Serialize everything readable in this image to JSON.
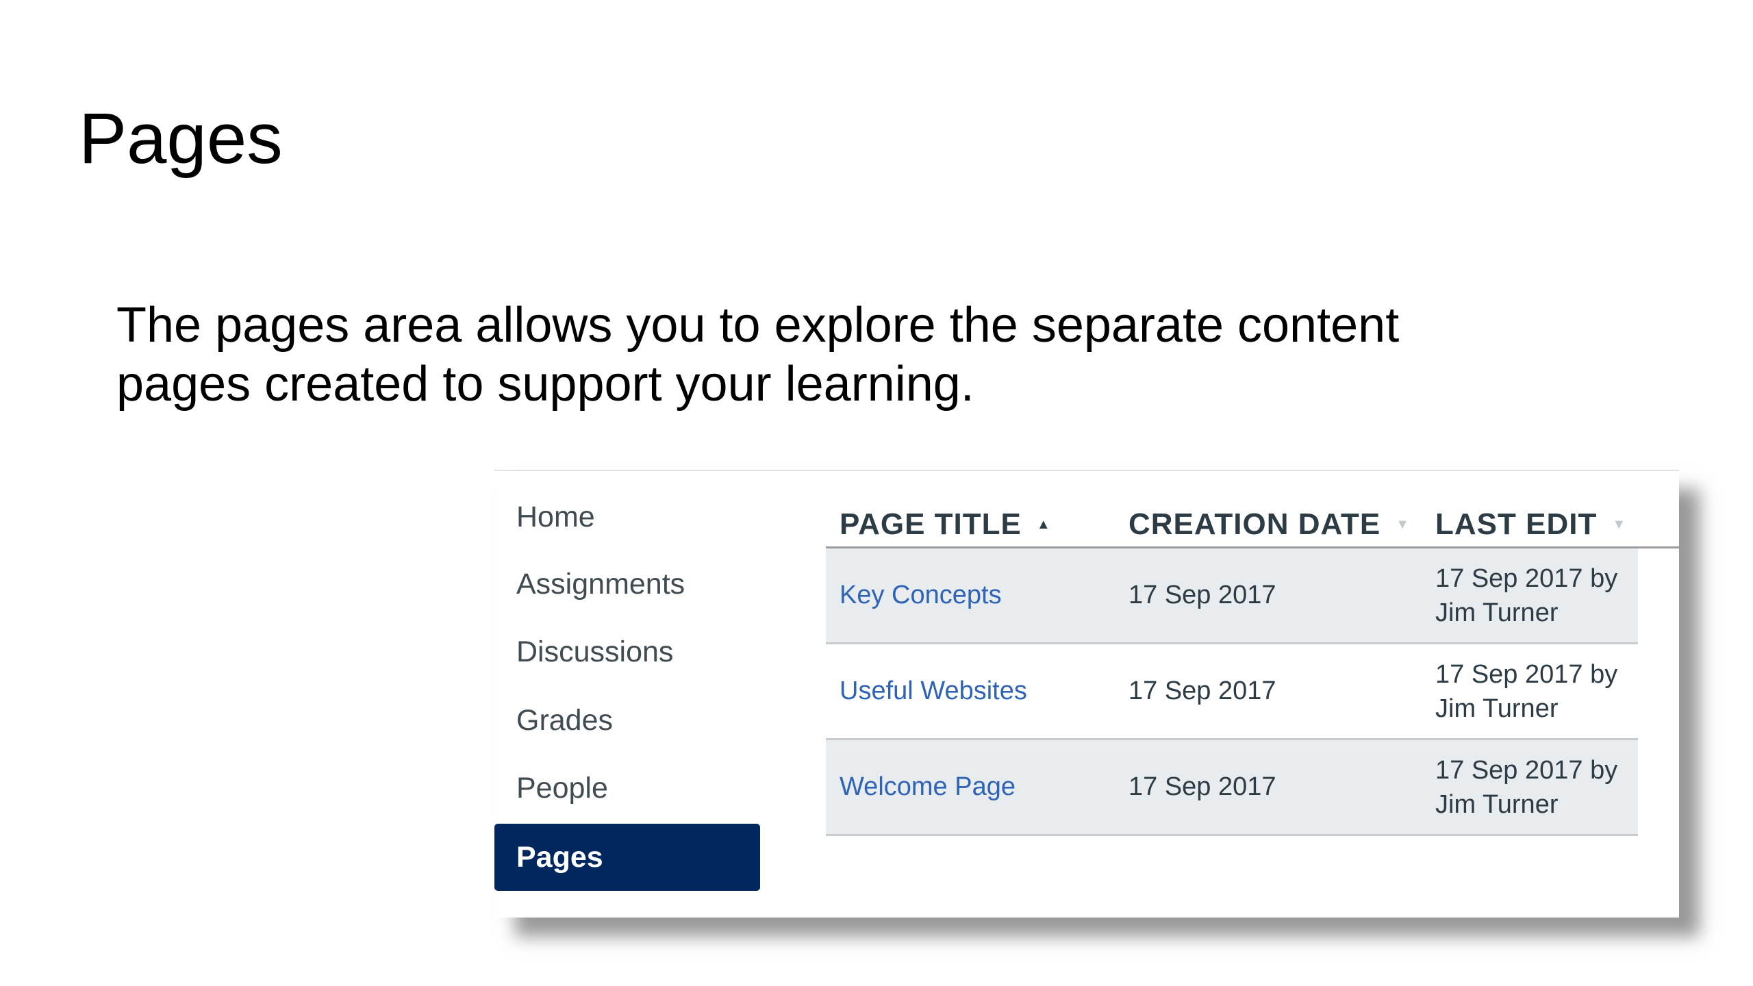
{
  "slide": {
    "title": "Pages",
    "body_lines": [
      "The pages area allows you to explore the separate content",
      "pages created to support your learning."
    ]
  },
  "screenshot": {
    "nav": {
      "items": [
        {
          "label": "Home"
        },
        {
          "label": "Assignments"
        },
        {
          "label": "Discussions"
        },
        {
          "label": "Grades"
        },
        {
          "label": "People"
        },
        {
          "label": "Pages",
          "active": true
        }
      ]
    },
    "table": {
      "columns": [
        {
          "label": "PAGE TITLE",
          "sort": "ascending"
        },
        {
          "label": "CREATION DATE",
          "sort": "none"
        },
        {
          "label": "LAST EDIT",
          "sort": "none"
        }
      ],
      "rows": [
        {
          "title": "Key Concepts",
          "created": "17 Sep 2017",
          "edit_line1": "17 Sep 2017 by",
          "edit_line2": "Jim Turner"
        },
        {
          "title": "Useful Websites",
          "created": "17 Sep 2017",
          "edit_line1": "17 Sep 2017 by",
          "edit_line2": "Jim Turner"
        },
        {
          "title": "Welcome Page",
          "created": "17 Sep 2017",
          "edit_line1": "17 Sep 2017 by",
          "edit_line2": "Jim Turner"
        }
      ]
    },
    "colors": {
      "active_nav_bg": "#00275e",
      "link": "#2e63b5",
      "row_shade": "#e9ecef"
    },
    "icons": {
      "sort_ascending": "triangle-up",
      "sort_unsorted": "triangle-down"
    }
  }
}
